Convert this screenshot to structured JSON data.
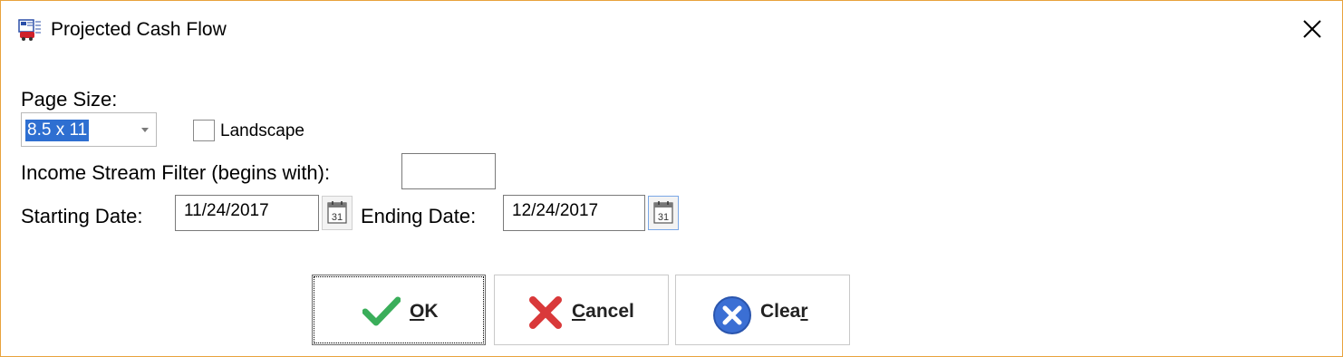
{
  "window": {
    "title": "Projected Cash Flow",
    "icon": "report-app-icon",
    "accent": "#e8a33d"
  },
  "page_size": {
    "label": "Page Size:",
    "value": "8.5 x 11",
    "landscape_label": "Landscape",
    "landscape_checked": false
  },
  "filter": {
    "label": "Income Stream Filter (begins with):",
    "value": ""
  },
  "dates": {
    "start_label": "Starting Date:",
    "start_value": "11/24/2017",
    "end_label": "Ending Date:",
    "end_value": "12/24/2017",
    "calendar_day": "31"
  },
  "buttons": {
    "ok": {
      "mnemonic": "O",
      "rest": "K"
    },
    "cancel": {
      "mnemonic": "C",
      "rest": "ancel"
    },
    "clear": {
      "before": "Clea",
      "mnemonic": "r"
    }
  }
}
